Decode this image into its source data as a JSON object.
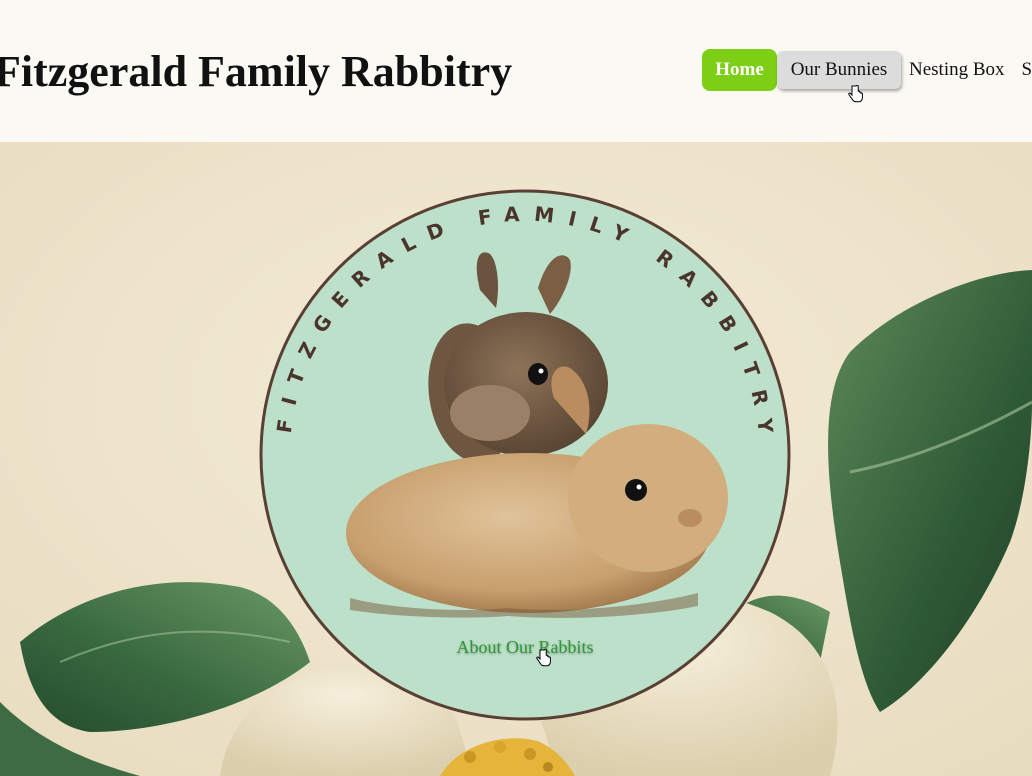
{
  "site": {
    "title": "Fitzgerald Family Rabbitry"
  },
  "nav": {
    "items": [
      {
        "label": "Home",
        "state": "active"
      },
      {
        "label": "Our Bunnies",
        "state": "hover"
      },
      {
        "label": "Nesting Box",
        "state": "default"
      },
      {
        "label": "S",
        "state": "default"
      }
    ]
  },
  "badge": {
    "arc_text": "FITZGERALD FAMILY RABBITRY",
    "link_label": "About Our Rabbits"
  },
  "colors": {
    "accent_green": "#7ccf14",
    "badge_fill": "#bde0cb",
    "badge_border": "#5a3f33",
    "link_green": "#2e9a34",
    "header_bg": "#fbf9f4"
  },
  "icons": {
    "cursor": "hand-pointer-icon"
  }
}
